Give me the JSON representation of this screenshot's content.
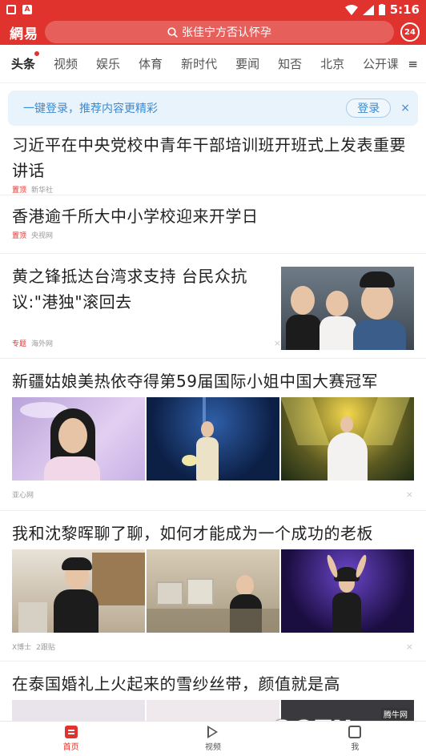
{
  "status_bar": {
    "time": "5:16",
    "left_badge": "A"
  },
  "header": {
    "logo": "網易",
    "search_placeholder": "张佳宁方否认怀孕",
    "clock_label": "24"
  },
  "tabs": [
    {
      "label": "头条",
      "active": true
    },
    {
      "label": "视频"
    },
    {
      "label": "娱乐"
    },
    {
      "label": "体育"
    },
    {
      "label": "新时代"
    },
    {
      "label": "要闻"
    },
    {
      "label": "知否"
    },
    {
      "label": "北京"
    },
    {
      "label": "公开课"
    }
  ],
  "tab_menu_icon": "≡",
  "login_banner": {
    "text": "一键登录，推荐内容更精彩",
    "button": "登录",
    "close": "×"
  },
  "articles": [
    {
      "title": "习近平在中央党校中青年干部培训班开班式上发表重要讲话",
      "tag": "置顶",
      "source": "新华社"
    },
    {
      "title": "香港逾千所大中小学校迎来开学日",
      "tag": "置顶",
      "source": "央视网"
    },
    {
      "title": "黄之锋抵达台湾求支持 台民众抗议:\"港独\"滚回去",
      "tag": "专题",
      "source": "海外网",
      "dislike": "×"
    },
    {
      "title": "新疆姑娘美热依夺得第59届国际小姐中国大赛冠军",
      "source": "亚心网",
      "dislike": "×"
    },
    {
      "title": "我和沈黎晖聊了聊，如何才能成为一个成功的老板",
      "source": "X博士",
      "comments": "2跟贴",
      "dislike": "×"
    },
    {
      "title": "在泰国婚礼上火起来的雪纱丝带，颜值就是高"
    }
  ],
  "bottom_nav": [
    {
      "label": "首页",
      "icon": "home-icon",
      "active": true
    },
    {
      "label": "视频",
      "icon": "play-icon"
    },
    {
      "label": "我",
      "icon": "profile-icon"
    }
  ],
  "watermark": {
    "text": "QQTN.com",
    "small": "腾牛网"
  },
  "colors": {
    "brand": "#e0332e",
    "login_blue": "#3a8ad4"
  }
}
